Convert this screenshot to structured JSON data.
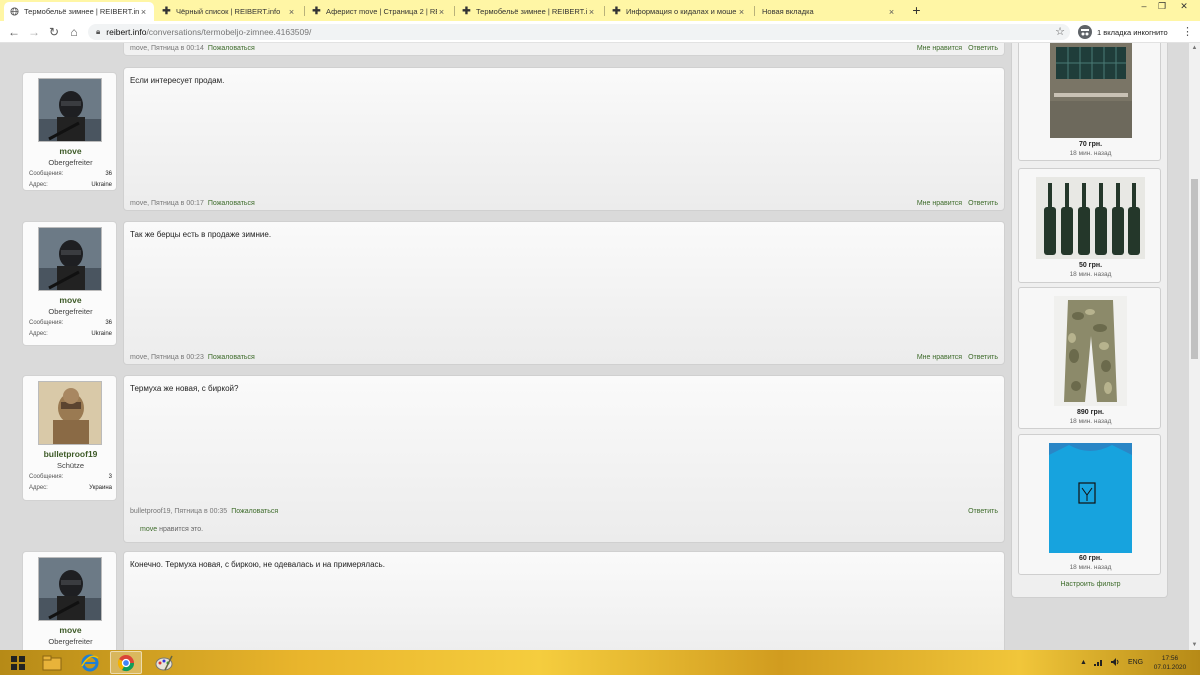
{
  "browser": {
    "tabs": [
      {
        "title": "Термобельё зимнее | REIBERT.in",
        "active": true
      },
      {
        "title": "Чёрный список | REIBERT.info",
        "active": false
      },
      {
        "title": "Аферист move | Страница 2 | RE",
        "active": false
      },
      {
        "title": "Термобельё зимнее | REIBERT.in",
        "active": false
      },
      {
        "title": "Информация о кидалах и моше",
        "active": false
      },
      {
        "title": "Новая вкладка",
        "active": false
      }
    ],
    "new_tab": "+",
    "url_host": "reibert.info",
    "url_path": "/conversations/termobeljo-zimnee.4163509/",
    "incognito_label": "1 вкладка инкогнито"
  },
  "thread": {
    "labels": {
      "posts": "Сообщения:",
      "location": "Адрес:",
      "like": "Мне нравится",
      "reply": "Ответить",
      "report": "Пожаловаться",
      "likes_suffix": "нравится это."
    },
    "first_meta": {
      "author_time": "move, Пятница в 00:14"
    },
    "posts": [
      {
        "user": "move",
        "title": "Obergefreiter",
        "posts": "36",
        "location": "Ukraine",
        "message": "Если интересует продам.",
        "author_time": "move, Пятница в 00:17"
      },
      {
        "user": "move",
        "title": "Obergefreiter",
        "posts": "36",
        "location": "Ukraine",
        "message": "Так же берцы есть в продаже зимние.",
        "author_time": "move, Пятница в 00:23"
      },
      {
        "user": "bulletproof19",
        "title": "Schütze",
        "posts": "3",
        "location": "Украина",
        "message": "Термуха же новая, с биркой?",
        "author_time": "bulletproof19, Пятница в 00:35",
        "liked_by": "move"
      },
      {
        "user": "move",
        "title": "Obergefreiter",
        "message": "Конечно. Термуха новая, с биркою, не одевалась и на примерялась."
      }
    ]
  },
  "sidebar": {
    "ads": [
      {
        "price": "70 грн.",
        "time": "18 мин. назад"
      },
      {
        "price": "50 грн.",
        "time": "18 мин. назад"
      },
      {
        "price": "890 грн.",
        "time": "18 мин. назад"
      },
      {
        "price": "60 грн.",
        "time": "18 мин. назад"
      }
    ],
    "filter_link": "Настроить фильтр"
  },
  "taskbar": {
    "lang": "ENG",
    "time": "17:56",
    "date": "07.01.2020"
  }
}
